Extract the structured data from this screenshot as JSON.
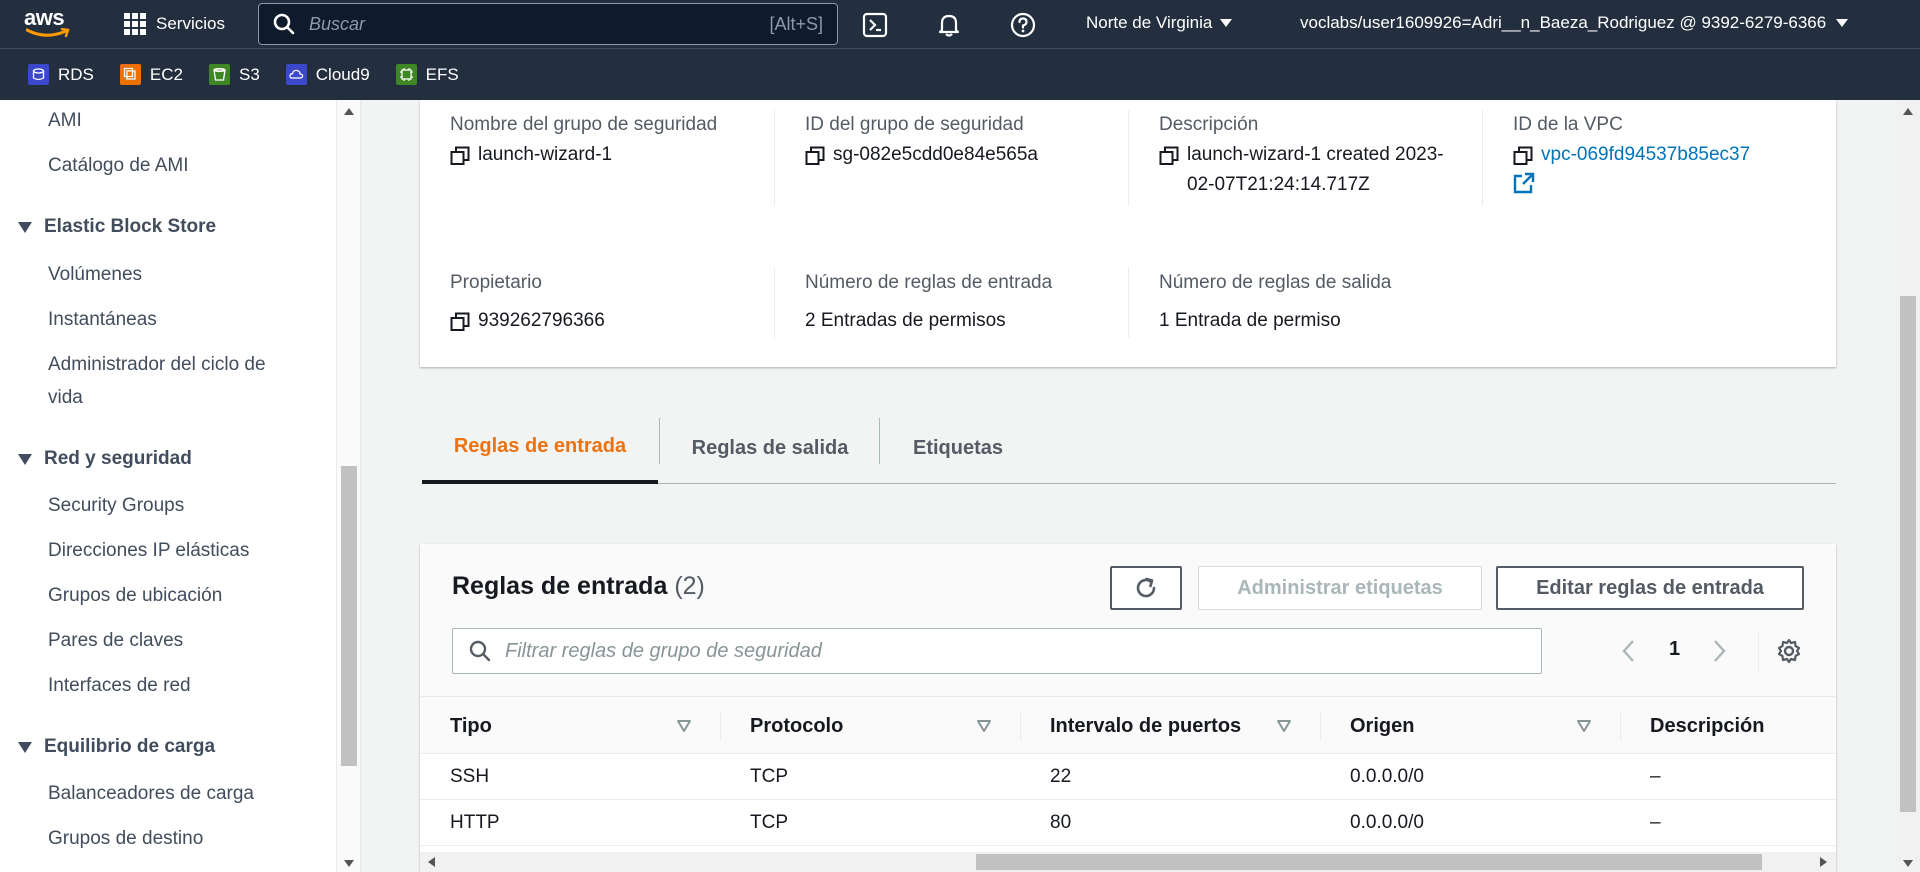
{
  "topnav": {
    "logo": "aws",
    "services_label": "Servicios",
    "search_placeholder": "Buscar",
    "search_shortcut": "[Alt+S]",
    "icons": [
      "cloudshell-icon",
      "bell-icon",
      "help-icon"
    ],
    "region": "Norte de Virginia",
    "account": "voclabs/user1609926=Adri__n_Baeza_Rodriguez @ 9392-6279-6366"
  },
  "favorites": [
    {
      "label": "RDS",
      "color": "#3b48cc"
    },
    {
      "label": "EC2",
      "color": "#ed7100"
    },
    {
      "label": "S3",
      "color": "#3f8624"
    },
    {
      "label": "Cloud9",
      "color": "#3b48cc"
    },
    {
      "label": "EFS",
      "color": "#3f8624"
    }
  ],
  "sidebar": {
    "items_top": [
      "AMI",
      "Catálogo de AMI"
    ],
    "sections": [
      {
        "title": "Elastic Block Store",
        "items": [
          "Volúmenes",
          "Instantáneas",
          "Administrador del ciclo de vida"
        ]
      },
      {
        "title": "Red y seguridad",
        "items": [
          "Security Groups",
          "Direcciones IP elásticas",
          "Grupos de ubicación",
          "Pares de claves",
          "Interfaces de red"
        ]
      },
      {
        "title": "Equilibrio de carga",
        "items": [
          "Balanceadores de carga",
          "Grupos de destino"
        ]
      }
    ]
  },
  "details": {
    "group_name_label": "Nombre del grupo de seguridad",
    "group_name": "launch-wizard-1",
    "group_id_label": "ID del grupo de seguridad",
    "group_id": "sg-082e5cdd0e84e565a",
    "description_label": "Descripción",
    "description": "launch-wizard-1 created 2023-02-07T21:24:14.717Z",
    "vpc_label": "ID de la VPC",
    "vpc_id": "vpc-069fd94537b85ec37",
    "owner_label": "Propietario",
    "owner": "939262796366",
    "inbound_count_label": "Número de reglas de entrada",
    "inbound_count": "2 Entradas de permisos",
    "outbound_count_label": "Número de reglas de salida",
    "outbound_count": "1 Entrada de permiso"
  },
  "tabs": [
    "Reglas de entrada",
    "Reglas de salida",
    "Etiquetas"
  ],
  "active_tab": 0,
  "rules": {
    "title": "Reglas de entrada",
    "count": "(2)",
    "manage_tags_label": "Administrar etiquetas",
    "edit_label": "Editar reglas de entrada",
    "filter_placeholder": "Filtrar reglas de grupo de seguridad",
    "page": "1",
    "columns": [
      "Tipo",
      "Protocolo",
      "Intervalo de puertos",
      "Origen",
      "Descripción"
    ],
    "rows": [
      [
        "SSH",
        "TCP",
        "22",
        "0.0.0.0/0",
        "–"
      ],
      [
        "HTTP",
        "TCP",
        "80",
        "0.0.0.0/0",
        "–"
      ]
    ]
  },
  "colors": {
    "nav_bg": "#232f3e",
    "accent_orange": "#ec7211",
    "link_blue": "#0073bb"
  }
}
